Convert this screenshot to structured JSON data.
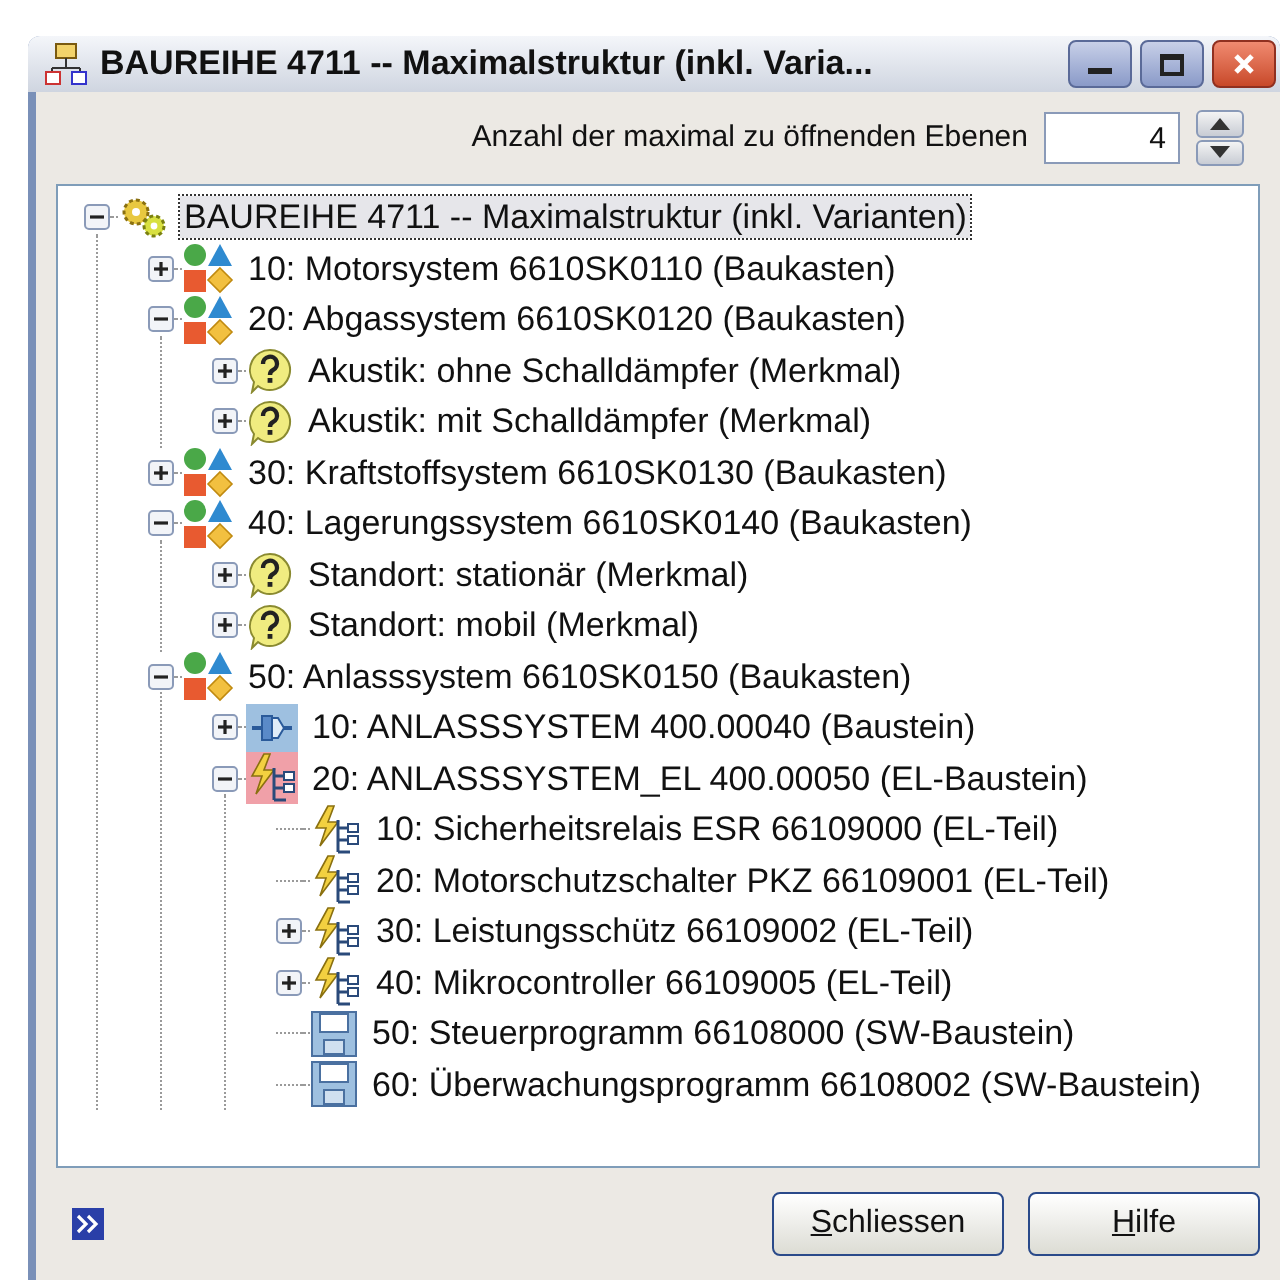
{
  "window": {
    "title": "BAUREIHE 4711 -- Maximalstruktur (inkl. Varia..."
  },
  "levels": {
    "label": "Anzahl der maximal zu öffnenden Ebenen",
    "value": "4"
  },
  "tree": [
    {
      "label": "BAUREIHE 4711 -- Maximalstruktur (inkl. Varianten)",
      "kind": "root",
      "expanded": true,
      "selected": true,
      "children": [
        {
          "label": "10: Motorsystem 6610SK0110 (Baukasten)",
          "kind": "baukasten",
          "expanded": false,
          "selected": false
        },
        {
          "label": "20: Abgassystem 6610SK0120 (Baukasten)",
          "kind": "baukasten",
          "expanded": true,
          "selected": false,
          "children": [
            {
              "label": "Akustik: ohne Schalldämpfer (Merkmal)",
              "kind": "merkmal",
              "expanded": false,
              "selected": false
            },
            {
              "label": "Akustik: mit Schalldämpfer (Merkmal)",
              "kind": "merkmal",
              "expanded": false,
              "selected": false
            }
          ]
        },
        {
          "label": "30: Kraftstoffsystem 6610SK0130 (Baukasten)",
          "kind": "baukasten",
          "expanded": false,
          "selected": false
        },
        {
          "label": "40: Lagerungssystem 6610SK0140 (Baukasten)",
          "kind": "baukasten",
          "expanded": true,
          "selected": false,
          "children": [
            {
              "label": "Standort: stationär (Merkmal)",
              "kind": "merkmal",
              "expanded": false,
              "selected": false
            },
            {
              "label": "Standort: mobil (Merkmal)",
              "kind": "merkmal",
              "expanded": false,
              "selected": false
            }
          ]
        },
        {
          "label": "50: Anlasssystem 6610SK0150 (Baukasten)",
          "kind": "baukasten",
          "expanded": true,
          "selected": false,
          "children": [
            {
              "label": "10: ANLASSSYSTEM 400.00040 (Baustein)",
              "kind": "baustein",
              "expanded": false,
              "selected": false
            },
            {
              "label": "20: ANLASSSYSTEM_EL 400.00050 (EL-Baustein)",
              "kind": "el-baustein",
              "expanded": true,
              "selected": false,
              "children": [
                {
                  "label": "10: Sicherheitsrelais ESR 66109000 (EL-Teil)",
                  "kind": "el-teil",
                  "selected": false
                },
                {
                  "label": "20: Motorschutzschalter PKZ 66109001 (EL-Teil)",
                  "kind": "el-teil",
                  "selected": false
                },
                {
                  "label": "30: Leistungsschütz 66109002 (EL-Teil)",
                  "kind": "el-teil",
                  "expanded": false,
                  "selected": false
                },
                {
                  "label": "40: Mikrocontroller 66109005 (EL-Teil)",
                  "kind": "el-teil",
                  "expanded": false,
                  "selected": false
                },
                {
                  "label": "50: Steuerprogramm 66108000 (SW-Baustein)",
                  "kind": "sw-baustein",
                  "selected": false
                },
                {
                  "label": "60: Überwachungsprogramm 66108002 (SW-Baustein)",
                  "kind": "sw-baustein",
                  "selected": false
                }
              ]
            }
          ]
        }
      ]
    }
  ],
  "buttons": [
    {
      "label": "Schliessen"
    },
    {
      "label": "Hilfe"
    }
  ]
}
